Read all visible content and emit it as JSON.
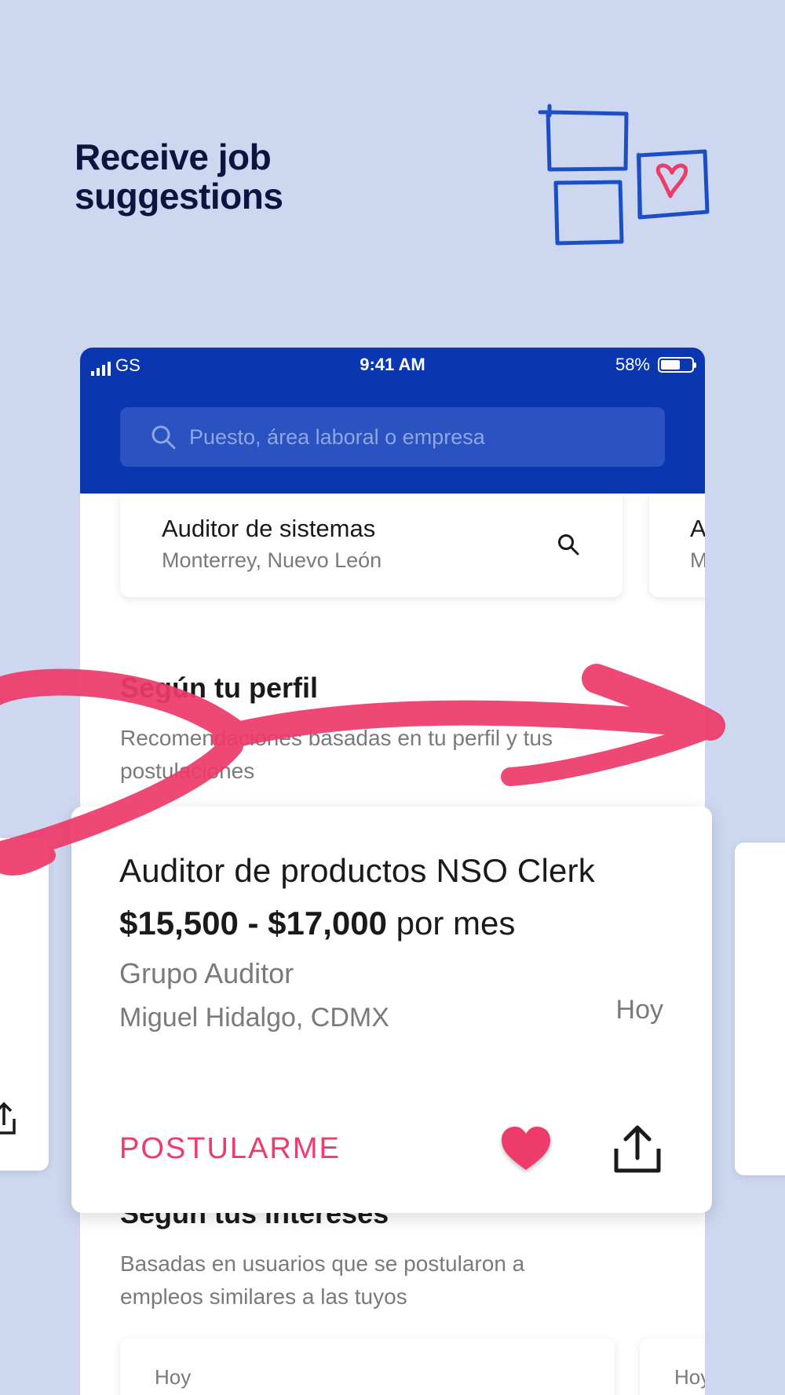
{
  "headline": "Receive job suggestions",
  "status_bar": {
    "carrier": "GS",
    "time": "9:41 AM",
    "battery": "58%"
  },
  "search": {
    "placeholder": "Puesto, área laboral o empresa"
  },
  "recent_searches": [
    {
      "title": "Auditor de sistemas",
      "subtitle": "Monterrey, Nuevo León"
    },
    {
      "title": "A",
      "subtitle": "M"
    }
  ],
  "section_profile": {
    "title": "Según tu perfil",
    "subtitle": "Recomendaciones basadas en tu perfil y tus postulaciones"
  },
  "job_card": {
    "title": "Auditor de productos NSO Clerk",
    "salary_range": "$15,500 - $17,000",
    "salary_period": "por mes",
    "company": "Grupo Auditor",
    "location": "Miguel Hidalgo, CDMX",
    "date": "Hoy",
    "apply_label": "POSTULARME"
  },
  "section_interests": {
    "title": "Según tus intereses",
    "subtitle": "Basadas en usuarios que se postularon a empleos similares a las tuyos"
  },
  "bottom_cards": [
    {
      "date": "Hoy"
    },
    {
      "date": "Hoy"
    }
  ],
  "colors": {
    "background": "#cdd7ef",
    "brand_blue": "#0a36b0",
    "accent_pink": "#ed3b6a",
    "headline": "#0d1440"
  }
}
